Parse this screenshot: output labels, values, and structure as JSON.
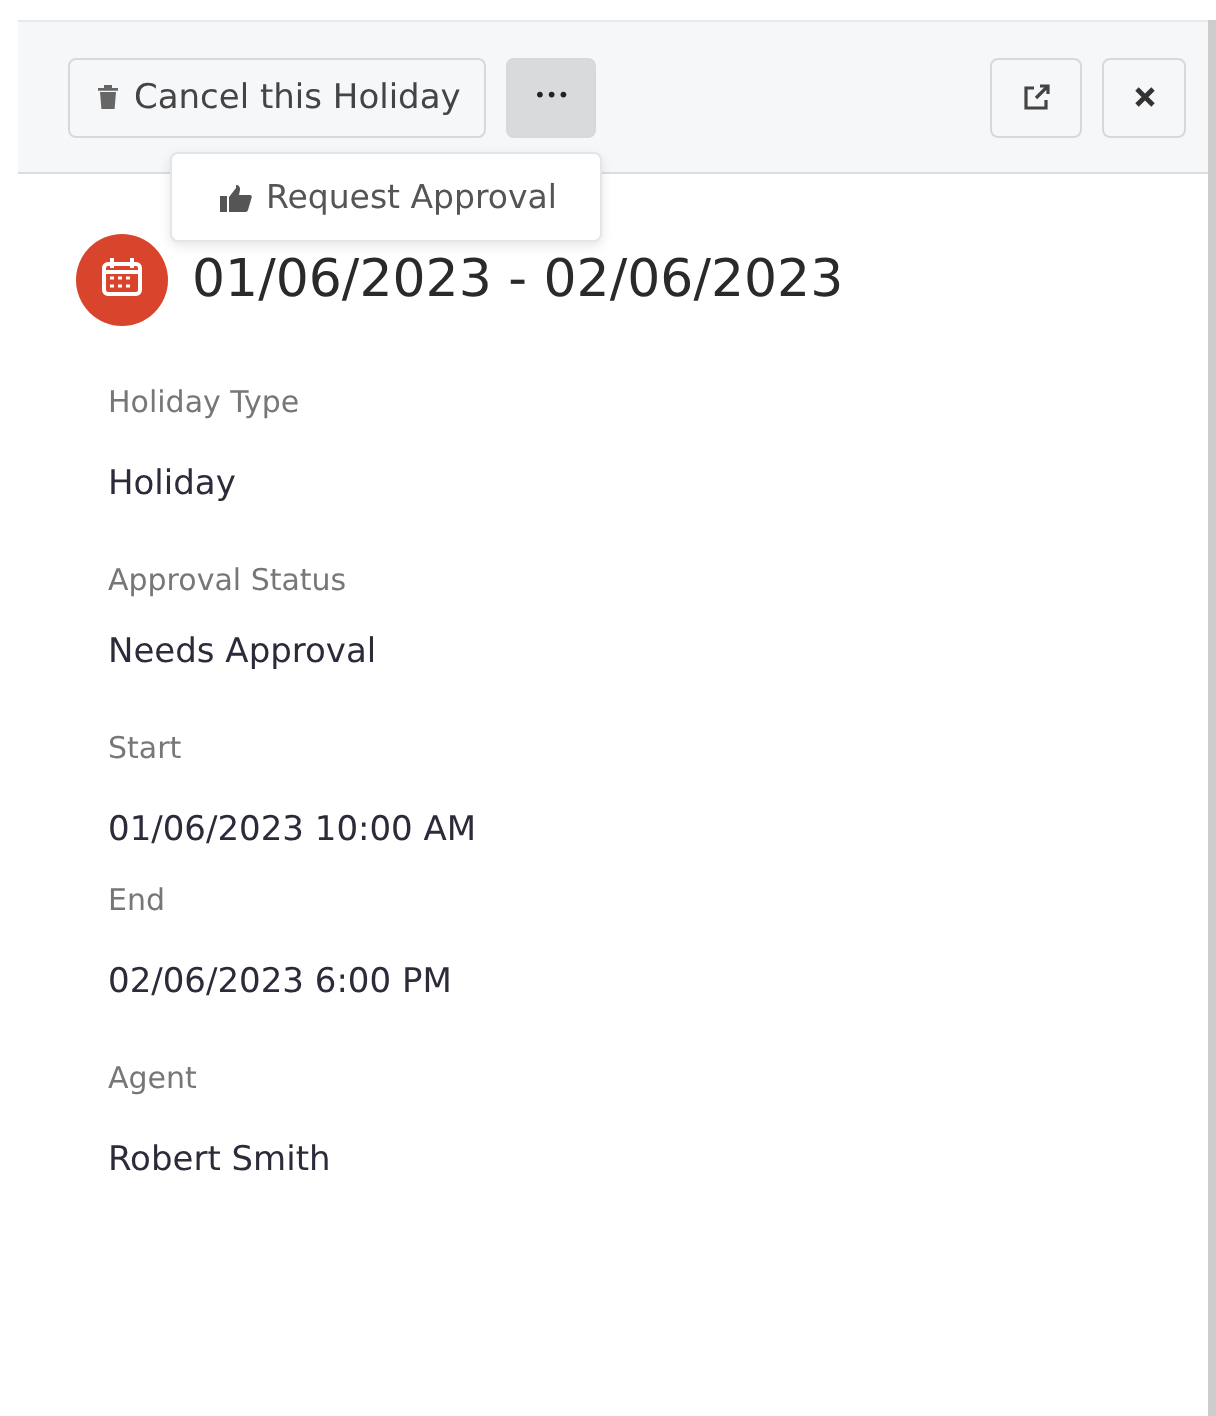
{
  "toolbar": {
    "cancel_button": "Cancel this Holiday",
    "more_button": {
      "label": "•••",
      "open": true
    },
    "menu": [
      "Request Approval"
    ]
  },
  "title": "01/06/2023 - 02/06/2023",
  "groups": [
    [
      {
        "label": "Holiday Type",
        "value": "Holiday"
      }
    ],
    [
      {
        "label": "Approval Status",
        "value": "Needs Approval"
      }
    ],
    [
      {
        "label": "Start",
        "value": "01/06/2023 10:00 AM"
      },
      {
        "label": "End",
        "value": "02/06/2023 6:00 PM"
      }
    ],
    [
      {
        "label": "Agent",
        "value": "Robert Smith"
      }
    ]
  ]
}
